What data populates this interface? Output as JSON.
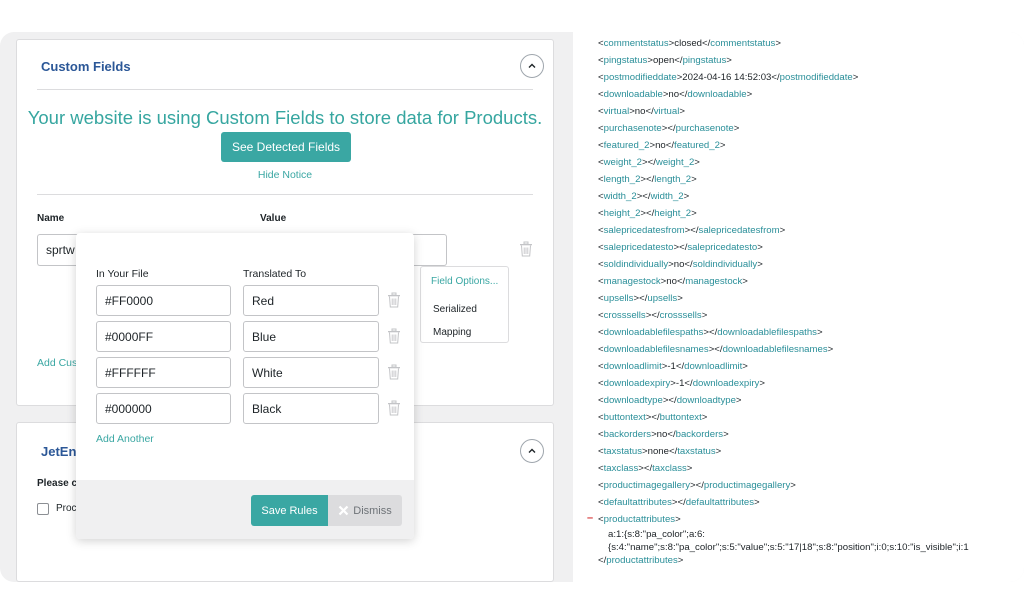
{
  "custom_fields": {
    "title": "Custom Fields",
    "notice": "Your website is using Custom Fields to store data for Products.",
    "see_detected_fields_label": "See Detected Fields",
    "hide_notice_label": "Hide Notice",
    "name_header": "Name",
    "value_header": "Value",
    "name_value": "sprtw",
    "add_custom_label": "Add Cus"
  },
  "rules_popup": {
    "in_your_file_header": "In Your File",
    "translated_to_header": "Translated To",
    "rows": [
      {
        "from": "#FF0000",
        "to": "Red"
      },
      {
        "from": "#0000FF",
        "to": "Blue"
      },
      {
        "from": "#FFFFFF",
        "to": "White"
      },
      {
        "from": "#000000",
        "to": "Black"
      }
    ],
    "add_another_label": "Add Another",
    "save_rules_label": "Save Rules",
    "dismiss_label": "Dismiss"
  },
  "field_options_menu": {
    "title": "Field Options...",
    "items": [
      "Serialized",
      "Mapping"
    ]
  },
  "jetengine": {
    "title": "JetEn",
    "please_text": "Please c",
    "checkbox_label": "Proc"
  },
  "xml_preview": {
    "lines": [
      {
        "tag": "commentstatus",
        "value": "closed"
      },
      {
        "tag": "pingstatus",
        "value": "open"
      },
      {
        "tag": "postmodifieddate",
        "value": "2024-04-16 14:52:03"
      },
      {
        "tag": "downloadable",
        "value": "no"
      },
      {
        "tag": "virtual",
        "value": "no"
      },
      {
        "tag": "purchasenote",
        "value": ""
      },
      {
        "tag": "featured_2",
        "value": "no"
      },
      {
        "tag": "weight_2",
        "value": ""
      },
      {
        "tag": "length_2",
        "value": ""
      },
      {
        "tag": "width_2",
        "value": ""
      },
      {
        "tag": "height_2",
        "value": ""
      },
      {
        "tag": "salepricedatesfrom",
        "value": ""
      },
      {
        "tag": "salepricedatesto",
        "value": ""
      },
      {
        "tag": "soldindividually",
        "value": "no"
      },
      {
        "tag": "managestock",
        "value": "no"
      },
      {
        "tag": "upsells",
        "value": ""
      },
      {
        "tag": "crosssells",
        "value": ""
      },
      {
        "tag": "downloadablefilespaths",
        "value": ""
      },
      {
        "tag": "downloadablefilesnames",
        "value": ""
      },
      {
        "tag": "downloadlimit",
        "value": "-1"
      },
      {
        "tag": "downloadexpiry",
        "value": "-1"
      },
      {
        "tag": "downloadtype",
        "value": ""
      },
      {
        "tag": "buttontext",
        "value": ""
      },
      {
        "tag": "backorders",
        "value": "no"
      },
      {
        "tag": "taxstatus",
        "value": "none"
      },
      {
        "tag": "taxclass",
        "value": ""
      },
      {
        "tag": "productimagegallery",
        "value": ""
      },
      {
        "tag": "defaultattributes",
        "value": ""
      }
    ],
    "expanded_tag": "productattributes",
    "expanded_value_line1": "a:1:{s:8:\"pa_color\";a:6:",
    "expanded_value_line2": "{s:4:\"name\";s:8:\"pa_color\";s:5:\"value\";s:5:\"17|18\";s:8:\"position\";i:0;s:10:\"is_visible\";i:1",
    "minus_glyph": "–"
  }
}
